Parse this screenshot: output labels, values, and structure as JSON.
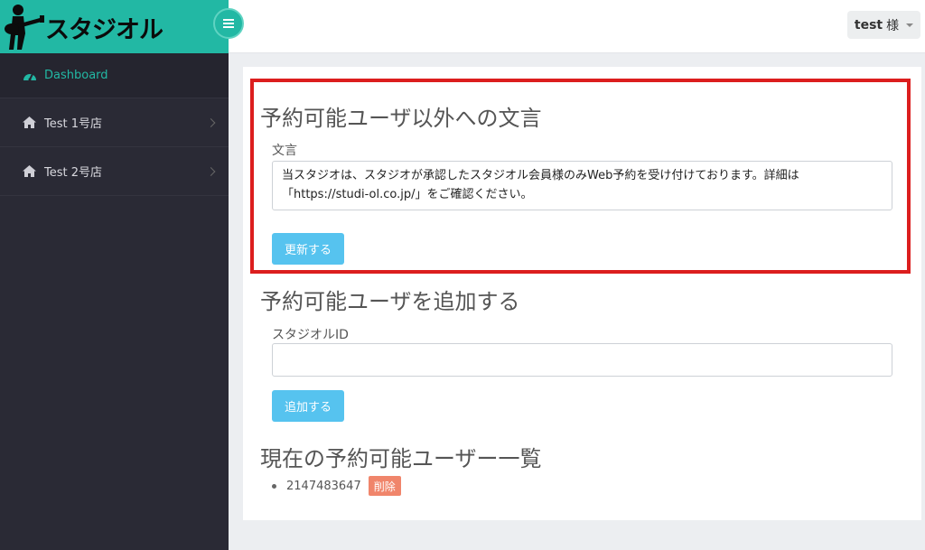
{
  "brand": {
    "logo_text": "スタジオル"
  },
  "header": {
    "user_name": "test",
    "user_suffix": "様"
  },
  "sidebar": {
    "items": [
      {
        "label": "Dashboard",
        "icon": "dashboard-icon"
      },
      {
        "label": "Test 1号店",
        "icon": "home-icon"
      },
      {
        "label": "Test 2号店",
        "icon": "home-icon"
      }
    ]
  },
  "section_message": {
    "title": "予約可能ユーザ以外への文言",
    "field_label": "文言",
    "field_value": "当スタジオは、スタジオが承認したスタジオル会員様のみWeb予約を受け付けております。詳細は「https://studi-ol.co.jp/」をご確認ください。",
    "button_label": "更新する"
  },
  "section_add": {
    "title": "予約可能ユーザを追加する",
    "field_label": "スタジオルID",
    "field_value": "",
    "button_label": "追加する"
  },
  "section_list": {
    "title": "現在の予約可能ユーザー一覧",
    "users": [
      {
        "id": "2147483647",
        "delete_label": "削除"
      }
    ]
  },
  "colors": {
    "brand": "#22b8a4",
    "sidebar_bg": "#2a2a35",
    "button": "#56c3ef",
    "delete_badge": "#f0856b",
    "highlight_border": "#dc1e1e"
  }
}
